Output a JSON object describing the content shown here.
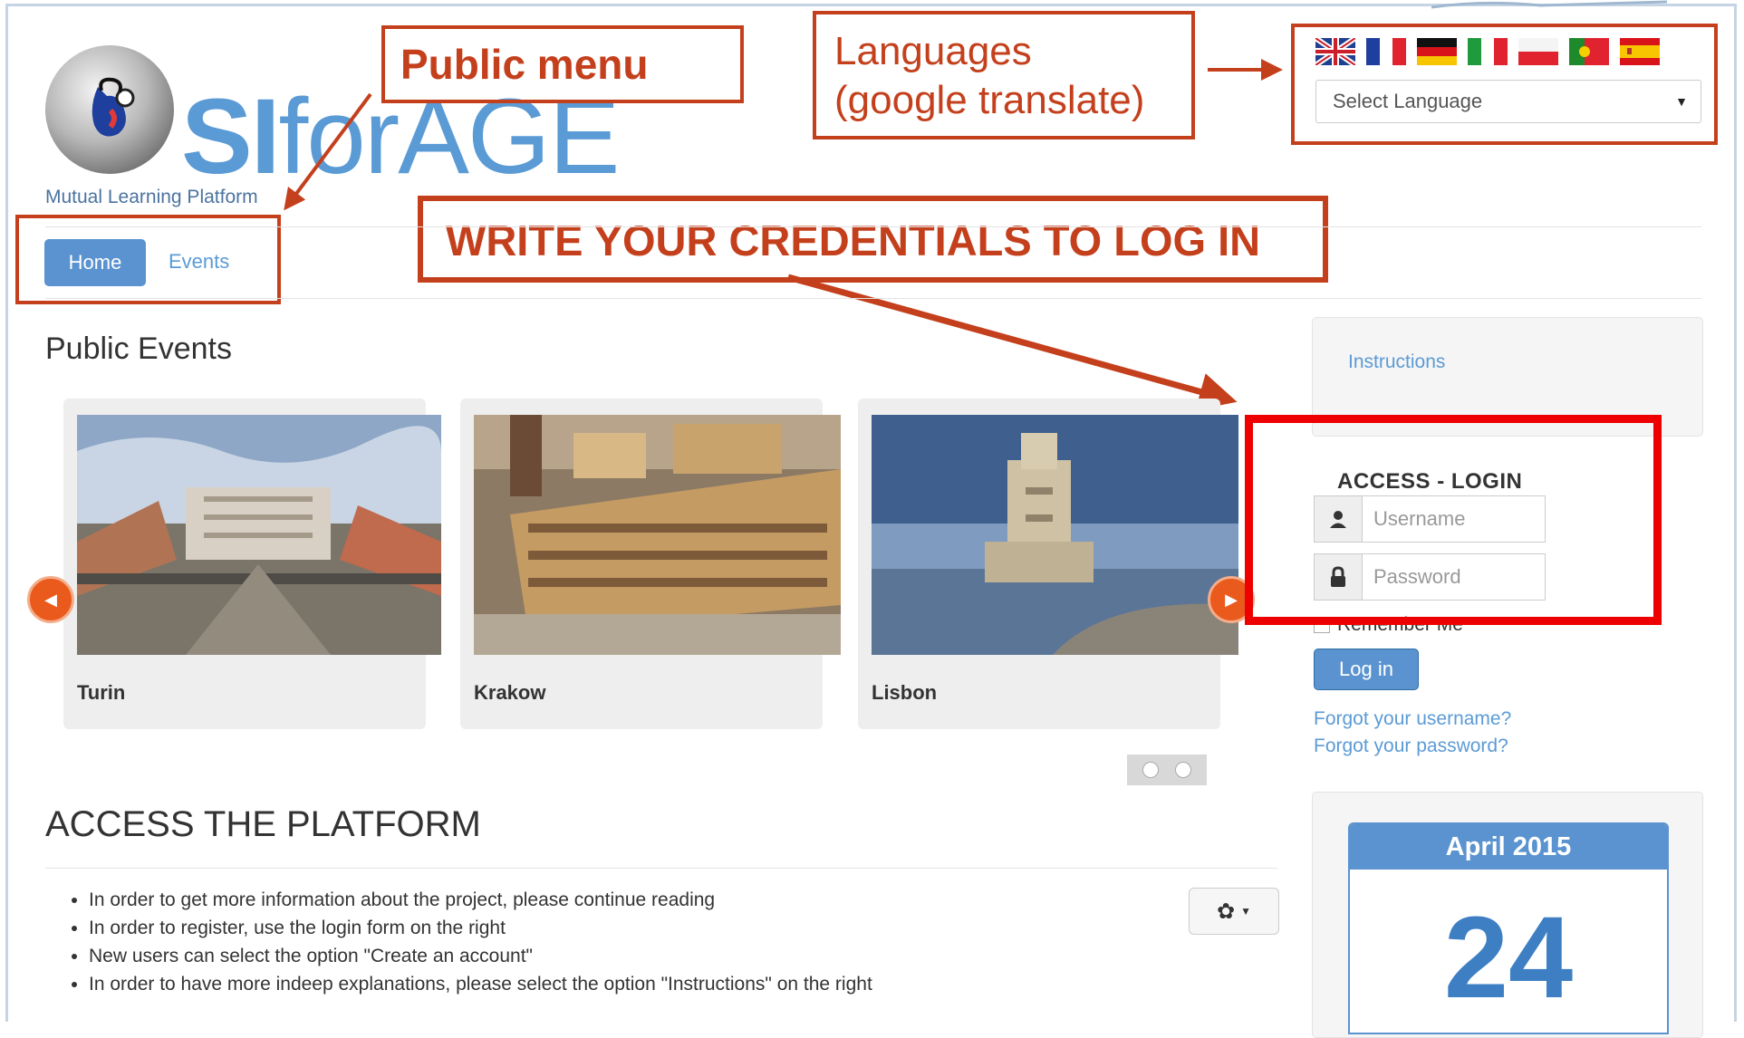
{
  "header": {
    "logo_bold": "SI",
    "logo_rest": "forAGE",
    "tagline": "Mutual Learning Platform"
  },
  "languages": {
    "flags": [
      "english-flag-icon",
      "french-flag-icon",
      "german-flag-icon",
      "italian-flag-icon",
      "polish-flag-icon",
      "portuguese-flag-icon",
      "spanish-flag-icon"
    ],
    "select_value": "Select Language"
  },
  "nav": {
    "home": "Home",
    "events": "Events"
  },
  "annotations": {
    "public_menu": "Public menu",
    "languages_line1": "Languages",
    "languages_line2": "(google translate)",
    "credentials": "WRITE YOUR CREDENTIALS TO LOG IN"
  },
  "events": {
    "heading": "Public Events",
    "cards": [
      {
        "title": "Turin"
      },
      {
        "title": "Krakow"
      },
      {
        "title": "Lisbon"
      }
    ]
  },
  "access": {
    "heading": "ACCESS THE PLATFORM",
    "items": [
      "In order to get more information about the project, please continue reading",
      "In order to register, use the login form on the right",
      "New users can select the option \"Create an account\"",
      "In order to have more indeep explanations, please select the option \"Instructions\" on the right"
    ]
  },
  "sidebar": {
    "instructions": "Instructions",
    "login_title": "ACCESS - LOGIN",
    "username_placeholder": "Username",
    "password_placeholder": "Password",
    "remember": "Remember Me",
    "login_button": "Log in",
    "forgot_username": "Forgot your username?",
    "forgot_password": "Forgot your password?"
  },
  "calendar": {
    "month": "April 2015",
    "day": "24"
  },
  "colors": {
    "accent": "#5a93cf",
    "annotation": "#c4401d",
    "highlight": "#ee0000"
  }
}
